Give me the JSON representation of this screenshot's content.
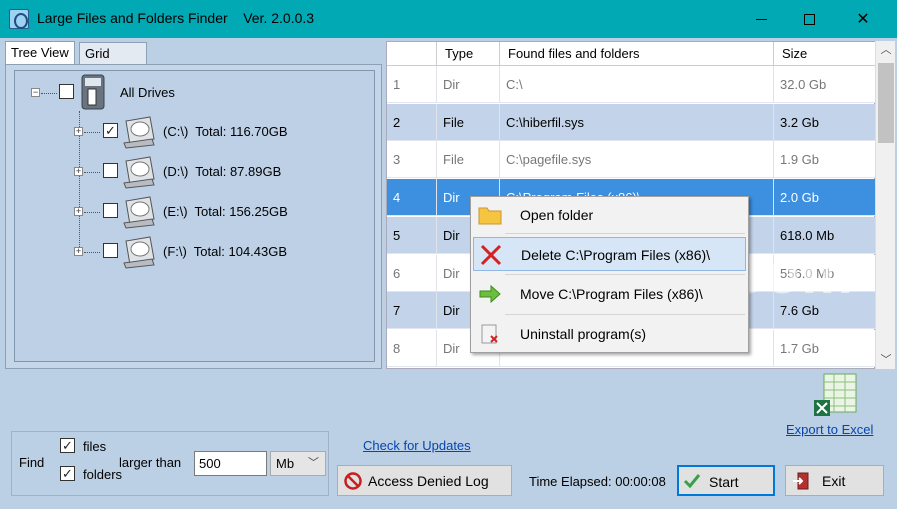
{
  "window": {
    "title": "Large Files and Folders Finder    Ver. 2.0.0.3"
  },
  "tabs": [
    {
      "label": "Tree View",
      "active": true
    },
    {
      "label": "Grid View",
      "active": false
    }
  ],
  "tree": {
    "root": {
      "label": "All Drives",
      "checked": false
    },
    "drives": [
      {
        "label": "(C:\\)  Total: 116.70GB",
        "checked": true
      },
      {
        "label": "(D:\\)  Total: 87.89GB",
        "checked": false
      },
      {
        "label": "(E:\\)  Total: 156.25GB",
        "checked": false
      },
      {
        "label": "(F:\\)  Total: 104.43GB",
        "checked": false
      }
    ]
  },
  "grid": {
    "columns": [
      "",
      "Type",
      "Found files and folders",
      "Size"
    ],
    "rows": [
      {
        "num": "1",
        "type": "Dir",
        "path": "C:\\",
        "size": "32.0 Gb",
        "style": "white"
      },
      {
        "num": "2",
        "type": "File",
        "path": "C:\\hiberfil.sys",
        "size": "3.2 Gb",
        "style": "blue"
      },
      {
        "num": "3",
        "type": "File",
        "path": "C:\\pagefile.sys",
        "size": "1.9 Gb",
        "style": "white"
      },
      {
        "num": "4",
        "type": "Dir",
        "path": "C:\\Program Files (x86)\\",
        "size": "2.0 Gb",
        "style": "sel"
      },
      {
        "num": "5",
        "type": "Dir",
        "path": "",
        "size": "618.0 Mb",
        "style": "blue"
      },
      {
        "num": "6",
        "type": "Dir",
        "path": "",
        "size": "556.0 Mb",
        "style": "white"
      },
      {
        "num": "7",
        "type": "Dir",
        "path": "",
        "size": "7.6 Gb",
        "style": "blue"
      },
      {
        "num": "8",
        "type": "Dir",
        "path": "",
        "size": "1.7 Gb",
        "style": "white"
      }
    ]
  },
  "context_menu": {
    "items": [
      {
        "label": "Open folder",
        "icon": "folder-icon"
      },
      {
        "label": "Delete C:\\Program Files (x86)\\",
        "icon": "delete-x-icon"
      },
      {
        "label": "Move C:\\Program Files (x86)\\",
        "icon": "move-arrow-icon"
      },
      {
        "label": "Uninstall program(s)",
        "icon": "uninstall-icon"
      }
    ]
  },
  "watermark": "SoftED.com",
  "find": {
    "label": "Find",
    "files_label": "files",
    "files_checked": true,
    "folders_label": "folders",
    "folders_checked": true,
    "larger_than_label": "larger than",
    "size_value": "500",
    "unit": "Mb"
  },
  "links": {
    "check_updates": "Check for Updates",
    "export_excel": "Export to Excel"
  },
  "buttons": {
    "access_denied": "Access Denied Log",
    "start": "Start",
    "exit": "Exit"
  },
  "status": {
    "time_elapsed": "Time Elapsed: 00:00:08"
  },
  "colors": {
    "titlebar": "#01a9b4",
    "selection": "#3d8fe0",
    "row_alt": "#c3d4ea",
    "link": "#0645ad"
  }
}
